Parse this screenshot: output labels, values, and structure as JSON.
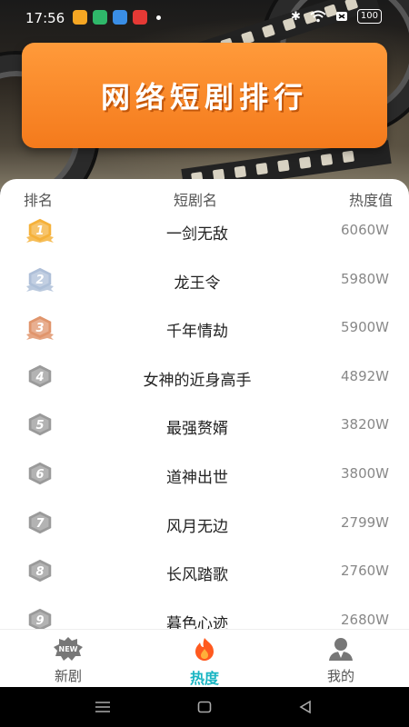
{
  "status_bar": {
    "time": "17:56",
    "battery": "100"
  },
  "banner": {
    "title": "网络短剧排行"
  },
  "table": {
    "headers": {
      "rank": "排名",
      "name": "短剧名",
      "heat": "热度值"
    },
    "rows": [
      {
        "rank": "1",
        "name": "一剑无敌",
        "heat": "6060W",
        "medal": "gold"
      },
      {
        "rank": "2",
        "name": "龙王令",
        "heat": "5980W",
        "medal": "silver"
      },
      {
        "rank": "3",
        "name": "千年情劫",
        "heat": "5900W",
        "medal": "bronze"
      },
      {
        "rank": "4",
        "name": "女神的近身高手",
        "heat": "4892W",
        "medal": "gray"
      },
      {
        "rank": "5",
        "name": "最强赘婿",
        "heat": "3820W",
        "medal": "gray"
      },
      {
        "rank": "6",
        "name": "道神出世",
        "heat": "3800W",
        "medal": "gray"
      },
      {
        "rank": "7",
        "name": "风月无边",
        "heat": "2799W",
        "medal": "gray"
      },
      {
        "rank": "8",
        "name": "长风踏歌",
        "heat": "2760W",
        "medal": "gray"
      },
      {
        "rank": "9",
        "name": "暮色心迹",
        "heat": "2680W",
        "medal": "gray"
      }
    ]
  },
  "tabs": [
    {
      "label": "新剧",
      "icon": "new-badge-icon"
    },
    {
      "label": "热度",
      "icon": "flame-icon",
      "active": true
    },
    {
      "label": "我的",
      "icon": "user-icon"
    }
  ],
  "colors": {
    "accent": "#19b5c3",
    "banner": "#f47a1c",
    "gold": "#f5b13a",
    "silver": "#aebfd8",
    "bronze": "#e0956c",
    "gray": "#9a9a9a"
  }
}
